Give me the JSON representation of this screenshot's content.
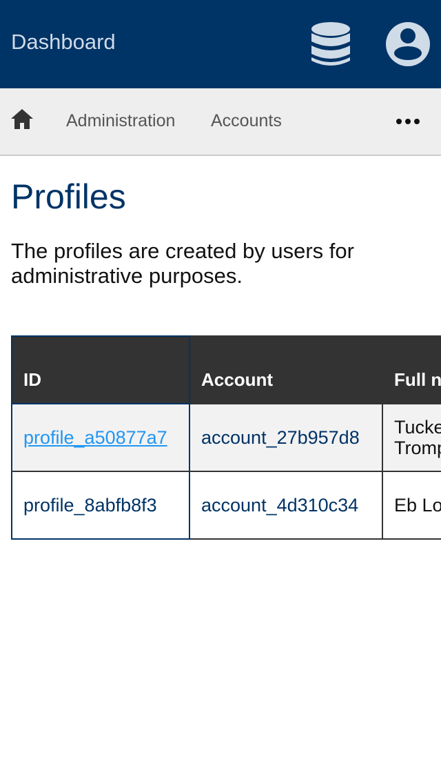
{
  "topbar": {
    "title": "Dashboard",
    "icons": [
      "database-icon",
      "user-account-icon"
    ],
    "background": "#003366"
  },
  "nav": {
    "home_icon": "home-icon",
    "links": [
      "Administration",
      "Accounts"
    ],
    "more_icon": "more-horizontal-icon"
  },
  "page": {
    "title": "Profiles",
    "description": "The profiles are created by users for administrative purposes."
  },
  "table": {
    "headers": [
      "ID",
      "Account",
      "Full name"
    ],
    "rows": [
      {
        "id": "profile_a50877a7",
        "account": "account_27b957d8",
        "full_name": "Tucker Tromp"
      },
      {
        "id": "profile_8abfb8f3",
        "account": "account_4d310c34",
        "full_name": "Eb Lonne"
      }
    ]
  },
  "colors": {
    "brand": "#003366",
    "link": "#2196f3",
    "header_bg": "#333333",
    "nav_bg": "#eeeeee"
  }
}
